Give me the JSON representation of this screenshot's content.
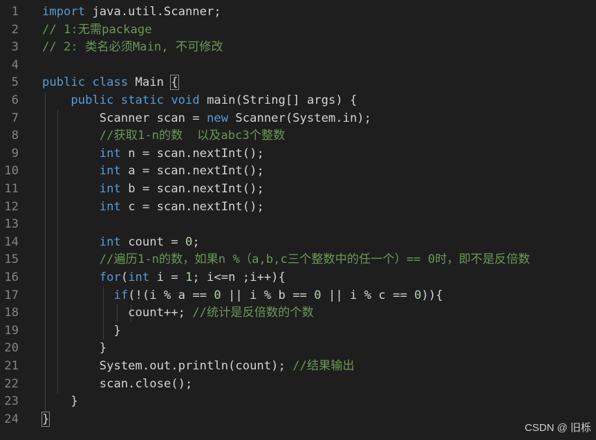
{
  "lines": [
    {
      "n": "1",
      "tokens": [
        {
          "t": "import",
          "c": "kw"
        },
        {
          "t": " java.util.Scanner;",
          "c": ""
        }
      ]
    },
    {
      "n": "2",
      "tokens": [
        {
          "t": "// 1:无需package",
          "c": "cm"
        }
      ]
    },
    {
      "n": "3",
      "tokens": [
        {
          "t": "// 2: 类名必须Main, 不可修改",
          "c": "cm"
        }
      ]
    },
    {
      "n": "4",
      "tokens": []
    },
    {
      "n": "5",
      "tokens": [
        {
          "t": "public",
          "c": "kw"
        },
        {
          "t": " ",
          "c": ""
        },
        {
          "t": "class",
          "c": "kw"
        },
        {
          "t": " Main ",
          "c": ""
        },
        {
          "t": "{",
          "c": "box"
        }
      ]
    },
    {
      "n": "6",
      "tokens": [
        {
          "t": "    ",
          "c": ""
        },
        {
          "t": "public",
          "c": "kw"
        },
        {
          "t": " ",
          "c": ""
        },
        {
          "t": "static",
          "c": "kw"
        },
        {
          "t": " ",
          "c": ""
        },
        {
          "t": "void",
          "c": "kw"
        },
        {
          "t": " main(String[] args) {",
          "c": ""
        }
      ]
    },
    {
      "n": "7",
      "tokens": [
        {
          "t": "        Scanner scan = ",
          "c": ""
        },
        {
          "t": "new",
          "c": "kw"
        },
        {
          "t": " Scanner(System.in);",
          "c": ""
        }
      ]
    },
    {
      "n": "8",
      "tokens": [
        {
          "t": "        ",
          "c": ""
        },
        {
          "t": "//获取1-n的数  以及abc3个整数",
          "c": "cm"
        }
      ]
    },
    {
      "n": "9",
      "tokens": [
        {
          "t": "        ",
          "c": ""
        },
        {
          "t": "int",
          "c": "kw"
        },
        {
          "t": " n = scan.nextInt();",
          "c": ""
        }
      ]
    },
    {
      "n": "10",
      "tokens": [
        {
          "t": "        ",
          "c": ""
        },
        {
          "t": "int",
          "c": "kw"
        },
        {
          "t": " a = scan.nextInt();",
          "c": ""
        }
      ]
    },
    {
      "n": "11",
      "tokens": [
        {
          "t": "        ",
          "c": ""
        },
        {
          "t": "int",
          "c": "kw"
        },
        {
          "t": " b = scan.nextInt();",
          "c": ""
        }
      ]
    },
    {
      "n": "12",
      "tokens": [
        {
          "t": "        ",
          "c": ""
        },
        {
          "t": "int",
          "c": "kw"
        },
        {
          "t": " c = scan.nextInt();",
          "c": ""
        }
      ]
    },
    {
      "n": "13",
      "tokens": []
    },
    {
      "n": "14",
      "tokens": [
        {
          "t": "        ",
          "c": ""
        },
        {
          "t": "int",
          "c": "kw"
        },
        {
          "t": " count = ",
          "c": ""
        },
        {
          "t": "0",
          "c": "nm"
        },
        {
          "t": ";",
          "c": ""
        }
      ]
    },
    {
      "n": "15",
      "tokens": [
        {
          "t": "        ",
          "c": ""
        },
        {
          "t": "//遍历1-n的数，如果n %（a,b,c三个整数中的任一个）== 0时，即不是反倍数",
          "c": "cm"
        }
      ]
    },
    {
      "n": "16",
      "tokens": [
        {
          "t": "        ",
          "c": ""
        },
        {
          "t": "for",
          "c": "kw"
        },
        {
          "t": "(",
          "c": ""
        },
        {
          "t": "int",
          "c": "kw"
        },
        {
          "t": " i = ",
          "c": ""
        },
        {
          "t": "1",
          "c": "nm"
        },
        {
          "t": "; i<=n ;i++){",
          "c": ""
        }
      ]
    },
    {
      "n": "17",
      "tokens": [
        {
          "t": "          ",
          "c": ""
        },
        {
          "t": "if",
          "c": "kw"
        },
        {
          "t": "(!(i % a == ",
          "c": ""
        },
        {
          "t": "0",
          "c": "nm"
        },
        {
          "t": " || i % b == ",
          "c": ""
        },
        {
          "t": "0",
          "c": "nm"
        },
        {
          "t": " || i % c == ",
          "c": ""
        },
        {
          "t": "0",
          "c": "nm"
        },
        {
          "t": ")){",
          "c": ""
        }
      ]
    },
    {
      "n": "18",
      "tokens": [
        {
          "t": "            count++; ",
          "c": ""
        },
        {
          "t": "//统计是反倍数的个数",
          "c": "cm"
        }
      ]
    },
    {
      "n": "19",
      "tokens": [
        {
          "t": "          }",
          "c": ""
        }
      ]
    },
    {
      "n": "20",
      "tokens": [
        {
          "t": "        }",
          "c": ""
        }
      ]
    },
    {
      "n": "21",
      "tokens": [
        {
          "t": "        System.out.println(count); ",
          "c": ""
        },
        {
          "t": "//结果输出",
          "c": "cm"
        }
      ]
    },
    {
      "n": "22",
      "tokens": [
        {
          "t": "        scan.close();",
          "c": ""
        }
      ]
    },
    {
      "n": "23",
      "tokens": [
        {
          "t": "    }",
          "c": ""
        }
      ]
    },
    {
      "n": "24",
      "tokens": [
        {
          "t": "}",
          "c": "box"
        }
      ]
    }
  ],
  "watermark": "CSDN @ 旧栎",
  "colors": {
    "background": "#1e1e1e",
    "keyword": "#569cd6",
    "comment": "#6a9955",
    "number": "#b5cea8",
    "text": "#d4d4d4",
    "line_number": "#858585"
  }
}
